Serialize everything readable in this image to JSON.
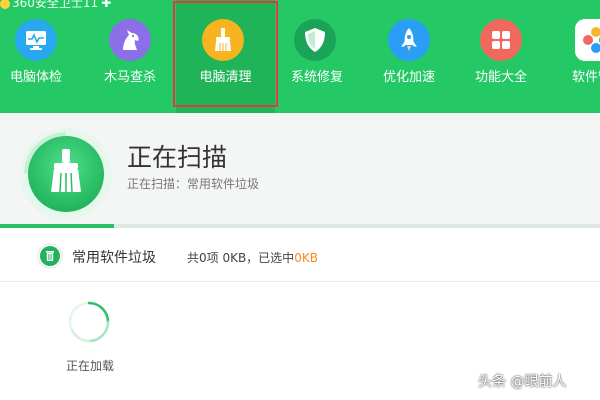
{
  "app": {
    "title": "360安全卫士11"
  },
  "nav": {
    "items": [
      {
        "label": "电脑体检",
        "icon": "monitor-icon",
        "color": "#2aa8ef"
      },
      {
        "label": "木马查杀",
        "icon": "horse-icon",
        "color": "#8b6ee8"
      },
      {
        "label": "电脑清理",
        "icon": "broom-icon",
        "color": "#f6b420",
        "active": true
      },
      {
        "label": "系统修复",
        "icon": "shield-icon",
        "color": "#1aa458"
      },
      {
        "label": "优化加速",
        "icon": "rocket-icon",
        "color": "#2a9df5"
      },
      {
        "label": "功能大全",
        "icon": "grid-icon",
        "color": "#f1685e"
      },
      {
        "label": "软件管家",
        "icon": "software-icon",
        "color": "#ffffff"
      }
    ]
  },
  "status": {
    "title": "正在扫描",
    "subtitle": "正在扫描：常用软件垃圾",
    "progress": 0.19
  },
  "category": {
    "name": "常用软件垃圾",
    "stats_prefix": "共0项 0KB，已选中",
    "selected": "0KB"
  },
  "loading": {
    "text": "正在加载"
  },
  "watermark": "头条 @眼前人"
}
